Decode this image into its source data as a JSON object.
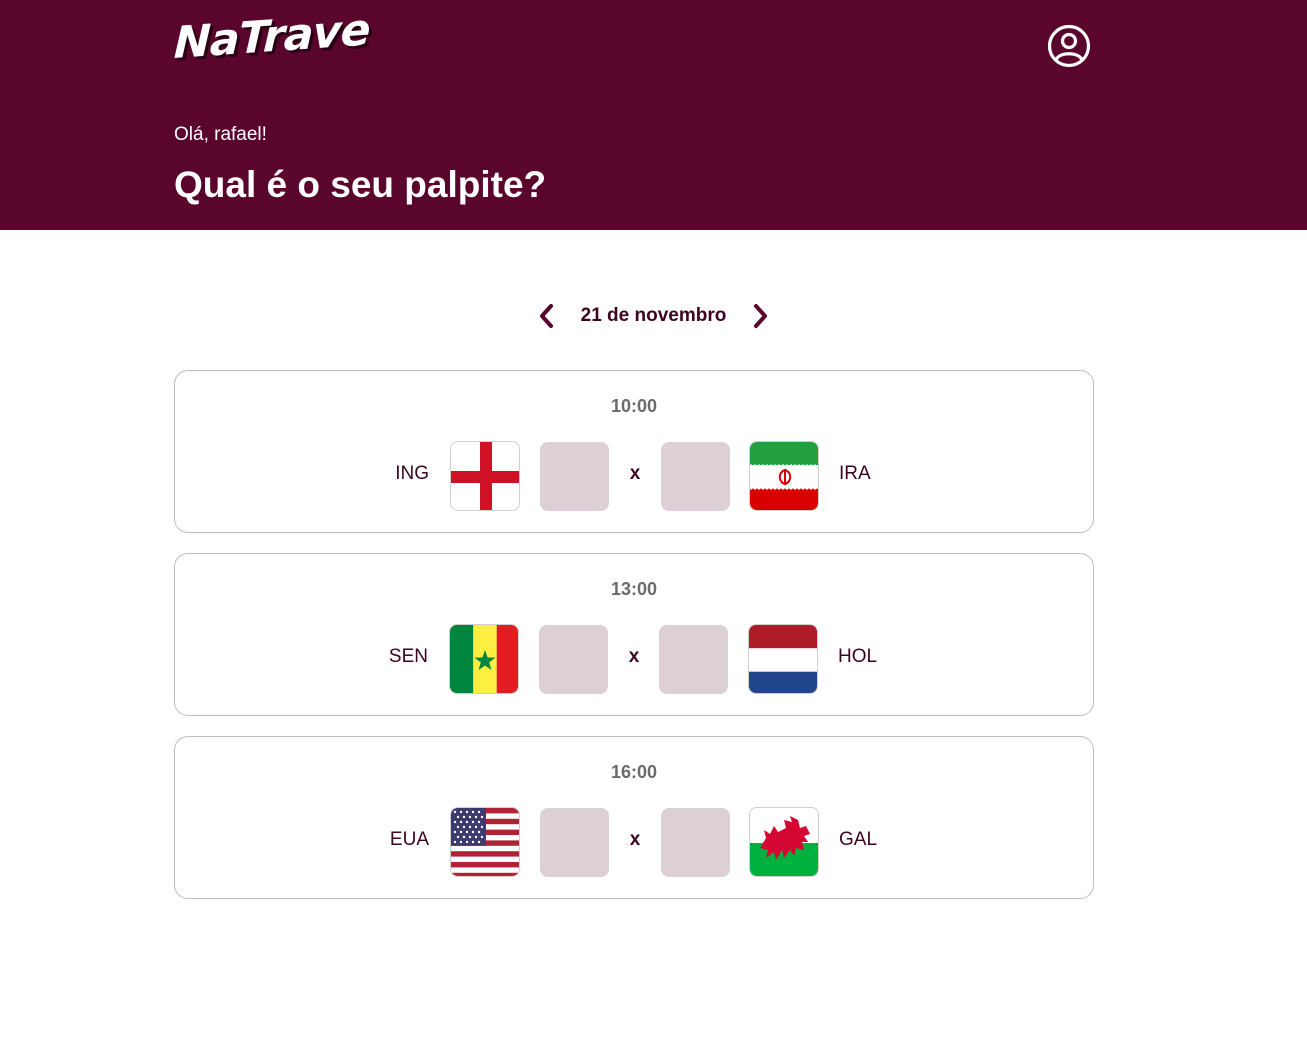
{
  "app": {
    "logo_text": "NaTrave"
  },
  "header": {
    "greeting": "Olá, rafael!",
    "question": "Qual é o seu palpite?"
  },
  "date_nav": {
    "current_date": "21 de novembro"
  },
  "colors": {
    "brand": "#5a052c",
    "score_bg": "#dcd0d6"
  },
  "games": [
    {
      "time": "10:00",
      "home": "ING",
      "away": "IRA",
      "vs": "x",
      "home_score": "",
      "away_score": ""
    },
    {
      "time": "13:00",
      "home": "SEN",
      "away": "HOL",
      "vs": "x",
      "home_score": "",
      "away_score": ""
    },
    {
      "time": "16:00",
      "home": "EUA",
      "away": "GAL",
      "vs": "x",
      "home_score": "",
      "away_score": ""
    }
  ]
}
